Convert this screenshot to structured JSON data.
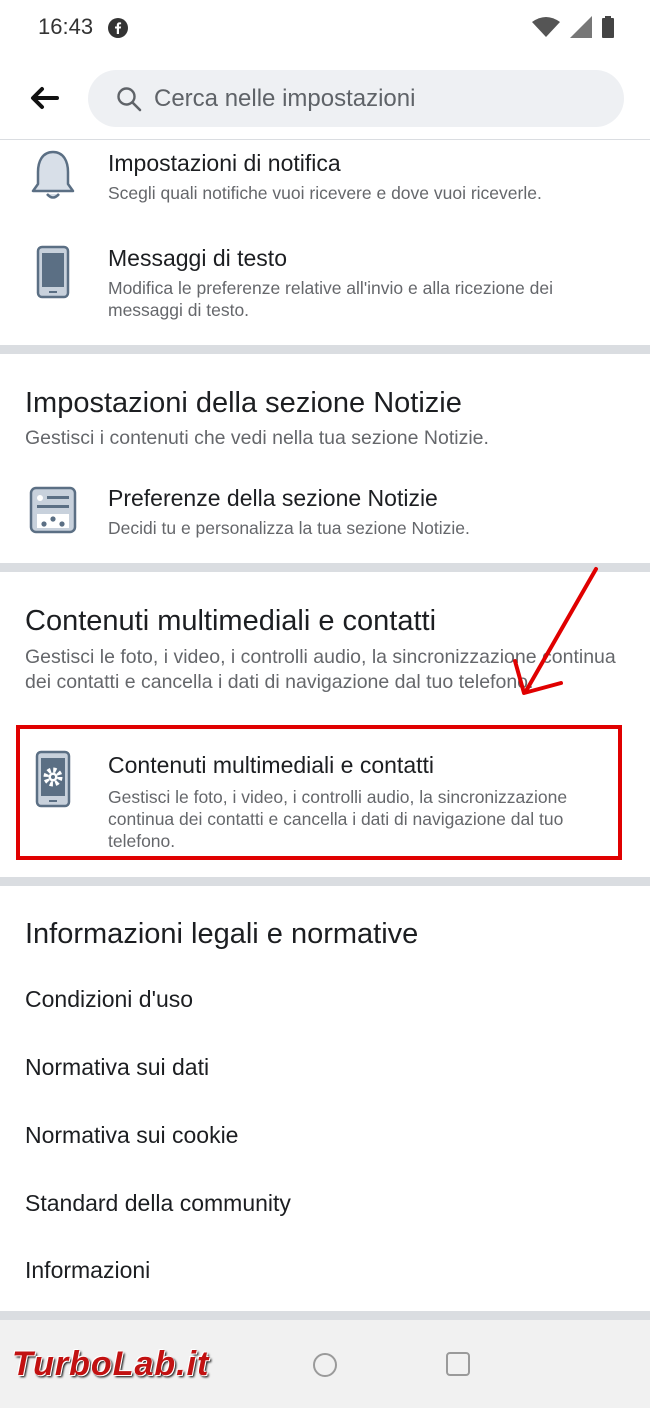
{
  "status_bar": {
    "time": "16:43"
  },
  "search": {
    "placeholder": "Cerca nelle impostazioni"
  },
  "notifications": {
    "title": "Impostazioni di notifica",
    "desc": "Scegli quali notifiche vuoi ricevere e dove vuoi riceverle."
  },
  "sms": {
    "title": "Messaggi di testo",
    "desc": "Modifica le preferenze relative all'invio e alla ricezione dei messaggi di testo."
  },
  "news_section": {
    "title": "Impostazioni della sezione Notizie",
    "desc": "Gestisci i contenuti che vedi nella tua sezione Notizie.",
    "item_title": "Preferenze della sezione Notizie",
    "item_desc": "Decidi tu e personalizza la tua sezione Notizie."
  },
  "media_section": {
    "title": "Contenuti multimediali e contatti",
    "desc": "Gestisci le foto, i video, i controlli audio, la sincronizzazione continua dei contatti e cancella i dati di navigazione dal tuo telefono.",
    "item_title": "Contenuti multimediali e contatti",
    "item_desc": "Gestisci le foto, i video, i controlli audio, la sincronizzazione continua dei contatti e cancella i dati di navigazione dal tuo telefono."
  },
  "legal_section": {
    "title": "Informazioni legali e normative",
    "items": [
      "Condizioni d'uso",
      "Normativa sui dati",
      "Normativa sui cookie",
      "Standard della community",
      "Informazioni"
    ]
  },
  "watermark": "TurboLab.it",
  "colors": {
    "highlight": "#e00000",
    "divider": "#dadde1",
    "search_bg": "#eef0f3"
  },
  "icons": [
    "facebook-icon",
    "wifi-icon",
    "signal-icon",
    "battery-icon",
    "back-arrow-icon",
    "search-icon",
    "bell-icon",
    "phone-icon",
    "news-preferences-icon",
    "phone-gear-icon"
  ]
}
